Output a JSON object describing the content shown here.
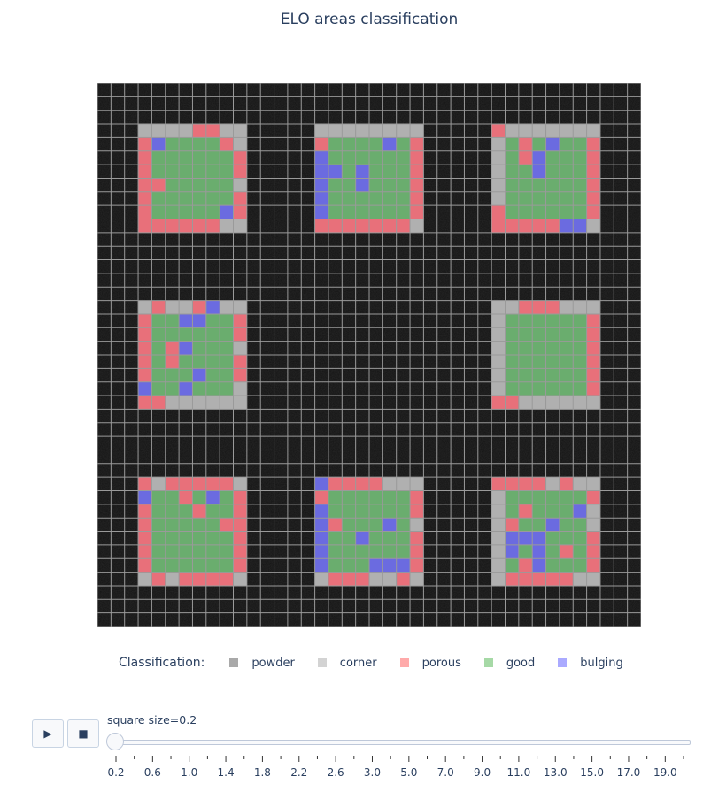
{
  "chart_data": {
    "type": "heatmap",
    "title": "ELO areas classification",
    "grid_size": 40,
    "legend": {
      "title": "Classification:",
      "placement": "bottom",
      "items": [
        {
          "label": "powder",
          "color": "#a9a9a9"
        },
        {
          "label": "corner",
          "color": "#d3d3d3"
        },
        {
          "label": "porous",
          "color": "#ffaaaa"
        },
        {
          "label": "good",
          "color": "#a6d9a6"
        },
        {
          "label": "bulging",
          "color": "#aaaaff"
        }
      ]
    },
    "cell_colors": {
      "powder": "#141414",
      "corner": "#b0b0b0",
      "porous": "#e8707a",
      "good": "#6aad6e",
      "bulging": "#6b6be0"
    },
    "squares": [
      {
        "rows": [
          3,
          10
        ],
        "cols": [
          3,
          10
        ],
        "porous": [
          [
            3,
            7
          ],
          [
            3,
            8
          ],
          [
            4,
            9
          ],
          [
            5,
            10
          ],
          [
            6,
            10
          ],
          [
            7,
            4
          ],
          [
            8,
            10
          ],
          [
            9,
            10
          ],
          [
            10,
            4
          ],
          [
            10,
            5
          ],
          [
            10,
            6
          ],
          [
            10,
            7
          ],
          [
            10,
            8
          ],
          [
            4,
            3
          ],
          [
            5,
            3
          ],
          [
            6,
            3
          ],
          [
            7,
            3
          ],
          [
            8,
            3
          ],
          [
            9,
            3
          ],
          [
            10,
            3
          ]
        ],
        "bulging": [
          [
            4,
            4
          ],
          [
            9,
            9
          ]
        ]
      },
      {
        "rows": [
          3,
          10
        ],
        "cols": [
          16,
          23
        ],
        "porous": [
          [
            4,
            16
          ],
          [
            5,
            16
          ],
          [
            10,
            16
          ],
          [
            10,
            17
          ],
          [
            10,
            18
          ],
          [
            10,
            19
          ],
          [
            10,
            20
          ],
          [
            10,
            21
          ],
          [
            10,
            22
          ],
          [
            7,
            23
          ],
          [
            8,
            23
          ],
          [
            9,
            23
          ],
          [
            4,
            23
          ],
          [
            5,
            23
          ],
          [
            6,
            23
          ]
        ],
        "bulging": [
          [
            4,
            21
          ],
          [
            5,
            16
          ],
          [
            6,
            16
          ],
          [
            6,
            17
          ],
          [
            6,
            19
          ],
          [
            7,
            19
          ],
          [
            7,
            16
          ],
          [
            8,
            16
          ],
          [
            9,
            16
          ]
        ]
      },
      {
        "rows": [
          3,
          10
        ],
        "cols": [
          29,
          36
        ],
        "porous": [
          [
            3,
            29
          ],
          [
            4,
            31
          ],
          [
            5,
            31
          ],
          [
            5,
            36
          ],
          [
            6,
            36
          ],
          [
            7,
            36
          ],
          [
            9,
            29
          ],
          [
            10,
            29
          ],
          [
            10,
            30
          ],
          [
            10,
            31
          ],
          [
            10,
            32
          ],
          [
            10,
            33
          ],
          [
            10,
            34
          ],
          [
            4,
            36
          ],
          [
            8,
            36
          ],
          [
            9,
            36
          ]
        ],
        "bulging": [
          [
            4,
            33
          ],
          [
            5,
            32
          ],
          [
            6,
            32
          ],
          [
            10,
            34
          ],
          [
            10,
            35
          ]
        ]
      },
      {
        "rows": [
          16,
          23
        ],
        "cols": [
          3,
          10
        ],
        "porous": [
          [
            16,
            4
          ],
          [
            16,
            7
          ],
          [
            17,
            3
          ],
          [
            18,
            3
          ],
          [
            19,
            3
          ],
          [
            19,
            5
          ],
          [
            20,
            3
          ],
          [
            20,
            5
          ],
          [
            21,
            3
          ],
          [
            21,
            10
          ],
          [
            22,
            3
          ],
          [
            23,
            3
          ],
          [
            23,
            4
          ],
          [
            17,
            10
          ],
          [
            18,
            10
          ],
          [
            20,
            10
          ]
        ],
        "bulging": [
          [
            16,
            8
          ],
          [
            17,
            6
          ],
          [
            17,
            7
          ],
          [
            19,
            6
          ],
          [
            21,
            7
          ],
          [
            22,
            3
          ],
          [
            22,
            6
          ]
        ]
      },
      {
        "rows": [
          16,
          23
        ],
        "cols": [
          29,
          36
        ],
        "porous": [
          [
            16,
            31
          ],
          [
            16,
            32
          ],
          [
            16,
            33
          ],
          [
            21,
            36
          ],
          [
            22,
            36
          ],
          [
            23,
            29
          ],
          [
            23,
            30
          ],
          [
            17,
            36
          ],
          [
            18,
            36
          ],
          [
            19,
            36
          ],
          [
            20,
            36
          ]
        ],
        "bulging": []
      },
      {
        "rows": [
          29,
          36
        ],
        "cols": [
          3,
          10
        ],
        "porous": [
          [
            29,
            3
          ],
          [
            29,
            5
          ],
          [
            29,
            6
          ],
          [
            29,
            7
          ],
          [
            29,
            8
          ],
          [
            29,
            9
          ],
          [
            30,
            6
          ],
          [
            30,
            10
          ],
          [
            31,
            7
          ],
          [
            31,
            10
          ],
          [
            32,
            9
          ],
          [
            33,
            10
          ],
          [
            34,
            3
          ],
          [
            35,
            3
          ],
          [
            36,
            4
          ],
          [
            36,
            6
          ],
          [
            36,
            7
          ],
          [
            36,
            8
          ],
          [
            36,
            9
          ],
          [
            32,
            10
          ],
          [
            34,
            10
          ],
          [
            35,
            10
          ],
          [
            31,
            3
          ],
          [
            32,
            3
          ],
          [
            33,
            3
          ]
        ],
        "bulging": [
          [
            30,
            3
          ],
          [
            30,
            8
          ]
        ]
      },
      {
        "rows": [
          29,
          36
        ],
        "cols": [
          16,
          23
        ],
        "porous": [
          [
            29,
            17
          ],
          [
            29,
            18
          ],
          [
            29,
            19
          ],
          [
            29,
            20
          ],
          [
            30,
            16
          ],
          [
            30,
            23
          ],
          [
            31,
            23
          ],
          [
            32,
            17
          ],
          [
            36,
            17
          ],
          [
            36,
            18
          ],
          [
            36,
            19
          ],
          [
            36,
            22
          ],
          [
            33,
            23
          ],
          [
            34,
            23
          ],
          [
            35,
            23
          ]
        ],
        "bulging": [
          [
            29,
            16
          ],
          [
            31,
            16
          ],
          [
            32,
            16
          ],
          [
            32,
            21
          ],
          [
            33,
            16
          ],
          [
            33,
            19
          ],
          [
            34,
            16
          ],
          [
            35,
            16
          ],
          [
            35,
            20
          ],
          [
            35,
            21
          ],
          [
            35,
            22
          ]
        ]
      },
      {
        "rows": [
          29,
          36
        ],
        "cols": [
          29,
          36
        ],
        "porous": [
          [
            29,
            29
          ],
          [
            29,
            30
          ],
          [
            29,
            31
          ],
          [
            29,
            32
          ],
          [
            29,
            34
          ],
          [
            30,
            36
          ],
          [
            31,
            31
          ],
          [
            32,
            30
          ],
          [
            34,
            34
          ],
          [
            35,
            31
          ],
          [
            36,
            30
          ],
          [
            36,
            31
          ],
          [
            36,
            32
          ],
          [
            36,
            33
          ],
          [
            36,
            34
          ],
          [
            33,
            36
          ],
          [
            34,
            36
          ],
          [
            35,
            36
          ]
        ],
        "bulging": [
          [
            31,
            35
          ],
          [
            32,
            33
          ],
          [
            33,
            30
          ],
          [
            33,
            31
          ],
          [
            33,
            32
          ],
          [
            34,
            30
          ],
          [
            34,
            32
          ],
          [
            35,
            32
          ]
        ]
      }
    ],
    "slider": {
      "label": "square size=0.2",
      "current": 0.2,
      "tick_labels": [
        "0.2",
        "0.6",
        "1.0",
        "1.4",
        "1.8",
        "2.2",
        "2.6",
        "3.0",
        "5.0",
        "7.0",
        "9.0",
        "11.0",
        "13.0",
        "15.0",
        "17.0",
        "19.0"
      ],
      "minor_ticks": [
        "0.2",
        "0.4",
        "0.6",
        "0.8",
        "1.0",
        "1.2",
        "1.4",
        "1.6",
        "1.8",
        "2.0",
        "2.2",
        "2.4",
        "2.6",
        "2.8",
        "3.0",
        "4.0",
        "5.0",
        "6.0",
        "7.0",
        "8.0",
        "9.0",
        "10.0",
        "11.0",
        "12.0",
        "13.0",
        "14.0",
        "15.0",
        "16.0",
        "17.0",
        "18.0",
        "19.0",
        "20.0"
      ]
    }
  },
  "controls": {
    "play_icon": "play-icon",
    "stop_icon": "stop-icon"
  }
}
